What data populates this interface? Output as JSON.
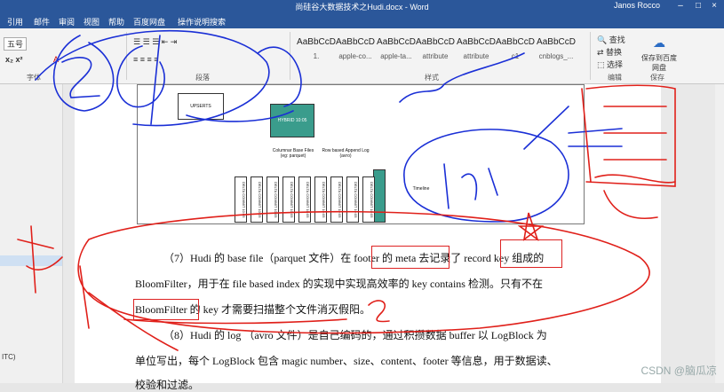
{
  "window": {
    "title": "尚硅谷大数据技术之Hudi.docx - Word",
    "user": "Janos Rocco"
  },
  "tabs": [
    "引用",
    "邮件",
    "审阅",
    "视图",
    "帮助",
    "百度网盘",
    "操作说明搜索"
  ],
  "ribbon": {
    "font_size": "五号",
    "group_font": "字体",
    "group_paragraph": "段落",
    "group_styles": "样式",
    "group_edit": "编辑",
    "group_save": "保存",
    "styles": [
      {
        "preview": "AaBbCcD",
        "name": "1."
      },
      {
        "preview": "AaBbCcD",
        "name": "apple-co..."
      },
      {
        "preview": "AaBbCcD",
        "name": "apple-ta..."
      },
      {
        "preview": "AaBbCcD",
        "name": "attribute"
      },
      {
        "preview": "AaBbCcD",
        "name": "attribute"
      },
      {
        "preview": "AaBbCcD",
        "name": "c1"
      },
      {
        "preview": "AaBbCcD",
        "name": "cnblogs_..."
      }
    ],
    "find": "查找",
    "replace": "替换",
    "select": "选择",
    "save_baidu": "保存到百度网盘"
  },
  "left_pane": {
    "itc": "ITC)"
  },
  "diagram": {
    "labels": [
      "UPSERTS",
      "HYBRID 10:05",
      "Row based Append Log (avro)",
      "Columnar Base Files (eg: parquet)",
      "Timeline"
    ],
    "commit_label": "DELTA COMMIT 10:05",
    "commit_count": 9
  },
  "paragraphs": {
    "p7_line1": "（7）Hudi 的 base file（parquet 文件）在 footer 的 meta 去记录了 record key 组成的",
    "p7_line2": "BloomFilter，用于在 file based index 的实现中实现高效率的 key contains 检测。只有不在",
    "p7_line3": "BloomFilter 的 key 才需要扫描整个文件消灭假阳。",
    "p8_line1": "（8）Hudi 的 log （avro 文件）是自己编码的，通过积攒数据 buffer 以 LogBlock 为",
    "p8_line2": "单位写出，每个 LogBlock 包含 magic number、size、content、footer 等信息，用于数据读、",
    "p8_line3": "校验和过滤。"
  },
  "watermark": "CSDN @脑瓜凉",
  "ink_color": "#1a2fd6",
  "ink_red": "#e0201a"
}
